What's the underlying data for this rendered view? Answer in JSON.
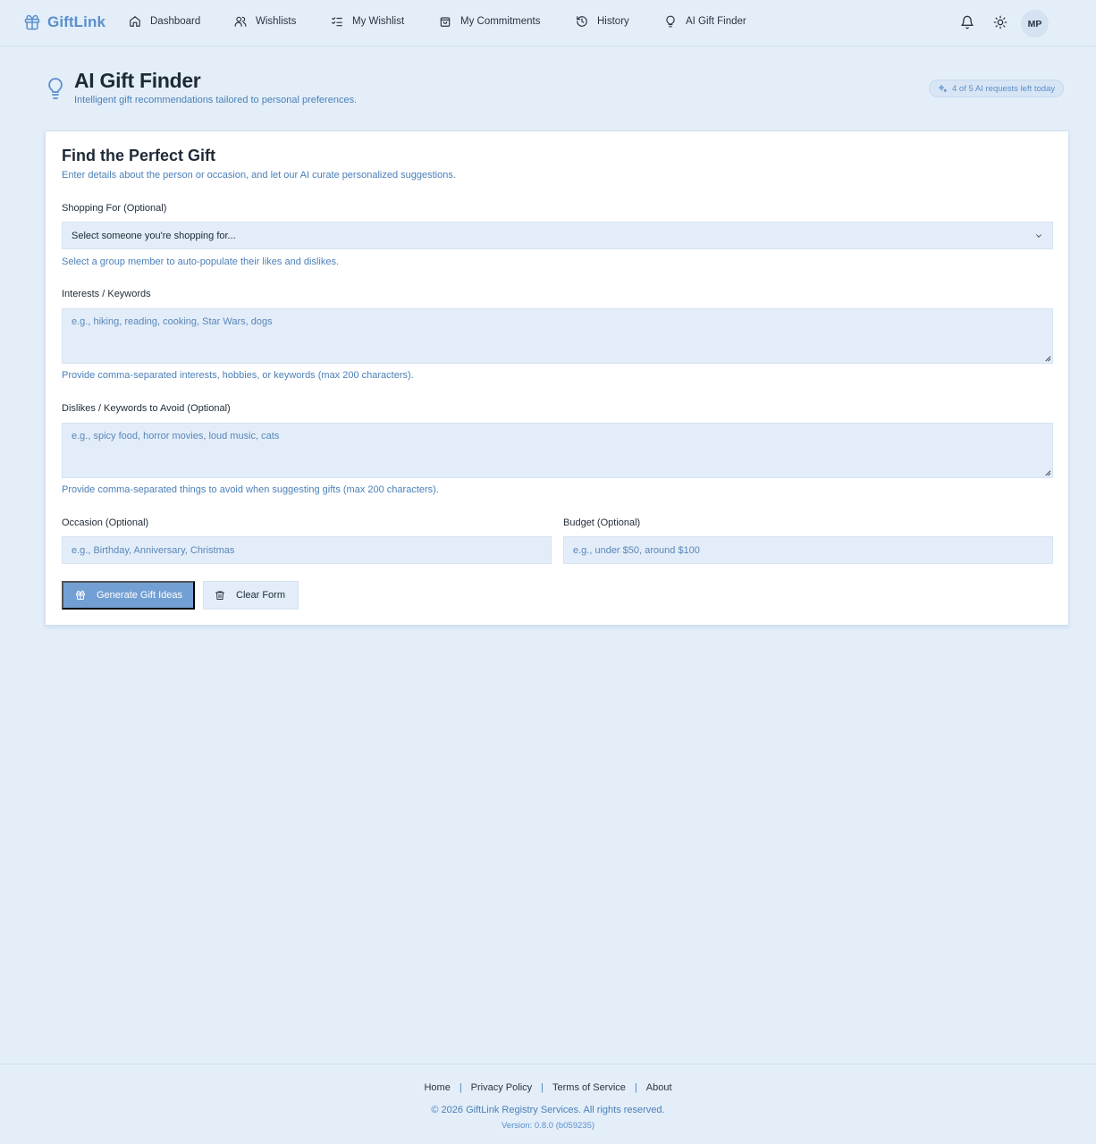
{
  "brand": {
    "name": "GiftLink",
    "icon": "gift-icon",
    "color": "#5b8fcb"
  },
  "nav": {
    "items": [
      {
        "label": "Dashboard",
        "icon": "home-icon"
      },
      {
        "label": "Wishlists",
        "icon": "users-icon"
      },
      {
        "label": "My Wishlist",
        "icon": "list-check-icon"
      },
      {
        "label": "My Commitments",
        "icon": "shopping-bag-icon"
      },
      {
        "label": "History",
        "icon": "history-icon"
      },
      {
        "label": "AI Gift Finder",
        "icon": "lightbulb-icon"
      }
    ],
    "notifications_icon": "bell-icon",
    "theme_icon": "sun-icon",
    "avatar_initials": "MP"
  },
  "page": {
    "title": "AI Gift Finder",
    "subtitle": "Intelligent gift recommendations tailored to personal preferences.",
    "icon": "lightbulb-icon",
    "quota_badge": "4 of 5 AI requests left today"
  },
  "form": {
    "title": "Find the Perfect Gift",
    "description": "Enter details about the person or occasion, and let our AI curate personalized suggestions.",
    "shopping_for": {
      "label": "Shopping For (Optional)",
      "selected": "Select someone you're shopping for...",
      "hint": "Select a group member to auto-populate their likes and dislikes."
    },
    "interests": {
      "label": "Interests / Keywords",
      "placeholder": "e.g., hiking, reading, cooking, Star Wars, dogs",
      "hint": "Provide comma-separated interests, hobbies, or keywords (max 200 characters)."
    },
    "dislikes": {
      "label": "Dislikes / Keywords to Avoid (Optional)",
      "placeholder": "e.g., spicy food, horror movies, loud music, cats",
      "hint": "Provide comma-separated things to avoid when suggesting gifts (max 200 characters)."
    },
    "occasion": {
      "label": "Occasion (Optional)",
      "placeholder": "e.g., Birthday, Anniversary, Christmas"
    },
    "budget": {
      "label": "Budget (Optional)",
      "placeholder": "e.g., under $50, around $100"
    },
    "generate_label": "Generate Gift Ideas",
    "clear_label": "Clear Form"
  },
  "footer": {
    "links": [
      "Home",
      "Privacy Policy",
      "Terms of Service",
      "About"
    ],
    "separator": "|",
    "copyright": "© 2026 GiftLink Registry Services. All rights reserved.",
    "version": "Version: 0.8.0 (b059235)"
  },
  "colors": {
    "background": "#e3eef9",
    "accent": "#5b8fcb",
    "primary_button": "#73a0d4",
    "input_bg": "#e2edf9"
  }
}
